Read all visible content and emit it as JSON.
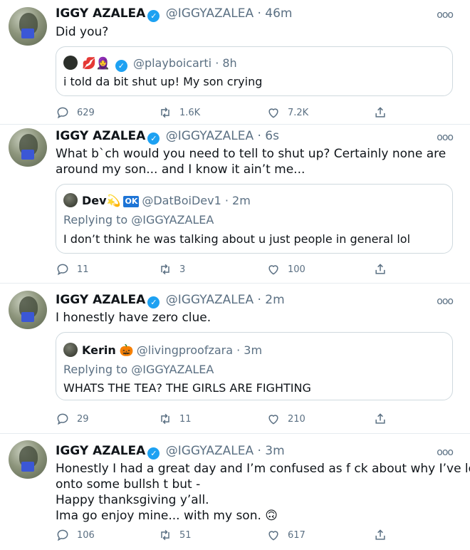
{
  "tweets": [
    {
      "name": "IGGY AZALEA",
      "handle": "@IGGYAZALEA",
      "time": "46m",
      "text": "Did you?",
      "quote": {
        "emojis": "💋🧕",
        "name": "",
        "handle": "@playboicarti",
        "time": "8h",
        "replying": "",
        "text": "i told da bit shut up! My son crying"
      },
      "replies": "629",
      "retweets": "1.6K",
      "likes": "7.2K"
    },
    {
      "name": "IGGY AZALEA",
      "handle": "@IGGYAZALEA",
      "time": "6s",
      "text": "What b`ch would you need to tell to shut up? Certainly none are around my son... and I know it ain’t me...",
      "quote": {
        "name": "Dev",
        "emojis": "💫",
        "badge": "OK",
        "handle": "@DatBoiDev1",
        "time": "2m",
        "replying": "Replying to @IGGYAZALEA",
        "text": "I don’t think he was talking about u just people in general lol"
      },
      "replies": "11",
      "retweets": "3",
      "likes": "100"
    },
    {
      "name": "IGGY AZALEA",
      "handle": "@IGGYAZALEA",
      "time": "2m",
      "text": "I honestly have zero clue.",
      "quote": {
        "name": "Kerin",
        "emojis": "🎃",
        "handle": "@livingproofzara",
        "time": "3m",
        "replying": "Replying to @IGGYAZALEA",
        "text": "WHATS THE TEA? THE GIRLS ARE FIGHTING"
      },
      "replies": "29",
      "retweets": "11",
      "likes": "210"
    },
    {
      "name": "IGGY AZALEA",
      "handle": "@IGGYAZALEA",
      "time": "3m",
      "text_lines": [
        "Honestly I had a great day and I’m confused as f  ck about why I’ve logged",
        "onto some bullsh  t but -",
        "Happy thanksgiving y’all.",
        "Ima go enjoy mine... with my son. 🙃"
      ],
      "replies": "106",
      "retweets": "51",
      "likes": "617"
    }
  ],
  "icons": {
    "reply": "reply-icon",
    "retweet": "retweet-icon",
    "like": "like-icon",
    "share": "share-icon",
    "more": "more-icon",
    "verified": "verified-icon"
  },
  "colors": {
    "accent": "#1da1f2",
    "secondary_text": "#5b7083",
    "border": "#cfd9de"
  }
}
